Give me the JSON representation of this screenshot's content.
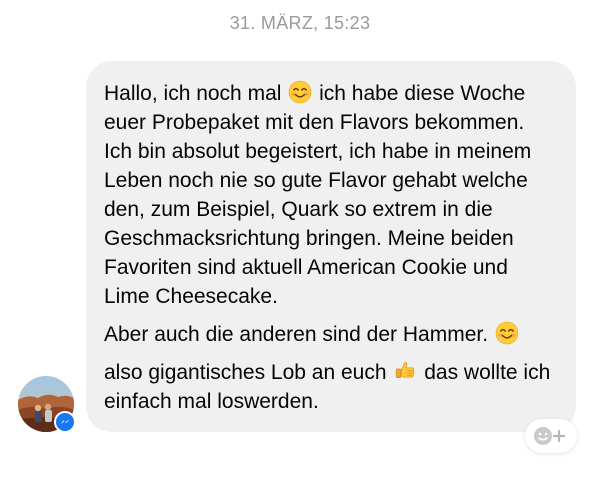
{
  "timestamp": "31. MÄRZ, 15:23",
  "message": {
    "p1": {
      "a": "Hallo, ich noch mal ",
      "emoji1": "smiling-face-emoji",
      "b": " ich habe diese Woche euer Probepaket mit den Flavors bekommen. Ich bin absolut begeistert, ich habe in meinem Leben noch nie so gute Flavor gehabt welche den, zum Beispiel, Quark so extrem in die Geschmacksrichtung bringen. Meine beiden Favoriten sind aktuell American Cookie und Lime Cheesecake."
    },
    "p2": {
      "a": "Aber auch die anderen sind der Hammer. ",
      "emoji1": "smiling-face-emoji"
    },
    "p3": {
      "a": "also gigantisches Lob an euch ",
      "emoji1": "thumbs-up-emoji",
      "b": " das wollte ich einfach mal loswerden."
    }
  },
  "colors": {
    "bubble": "#f0f0f0",
    "timestamp": "#9a9a9a",
    "messenger_blue": "#1877f2",
    "text": "#050505"
  },
  "icons": {
    "badge": "messenger-icon",
    "react": "add-reaction-icon"
  }
}
